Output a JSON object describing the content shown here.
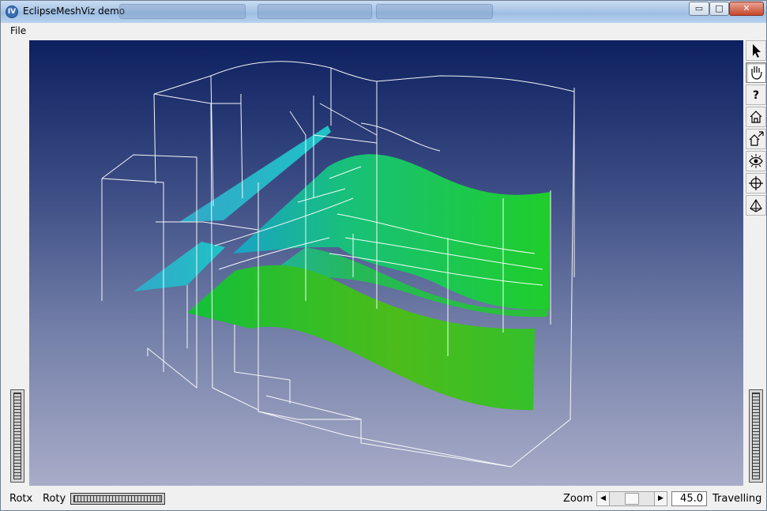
{
  "window": {
    "title": "EclipseMeshViz demo",
    "app_icon": "IV",
    "controls": {
      "minimize": "▭",
      "maximize": "□",
      "close": "✕"
    }
  },
  "menu": {
    "file": "File"
  },
  "toolbar": {
    "tools": [
      {
        "name": "select-arrow-icon",
        "active": false
      },
      {
        "name": "hand-view-icon",
        "active": true
      },
      {
        "name": "help-question-icon",
        "active": false
      },
      {
        "name": "home-icon",
        "active": false
      },
      {
        "name": "set-home-icon",
        "active": false
      },
      {
        "name": "view-all-eye-icon",
        "active": false
      },
      {
        "name": "seek-target-icon",
        "active": false
      },
      {
        "name": "projection-cube-icon",
        "active": false
      }
    ]
  },
  "bottom": {
    "rotx_label": "Rotx",
    "roty_label": "Roty",
    "zoom_label": "Zoom",
    "zoom_value": "45.0",
    "travelling_label": "Travelling"
  },
  "viewer": {
    "background_top": "#0d2060",
    "background_bottom": "#a8acc8",
    "surface_green": "#1ec62a",
    "surface_cyan": "#1fb9c9",
    "wireframe_color": "#ffffff"
  }
}
